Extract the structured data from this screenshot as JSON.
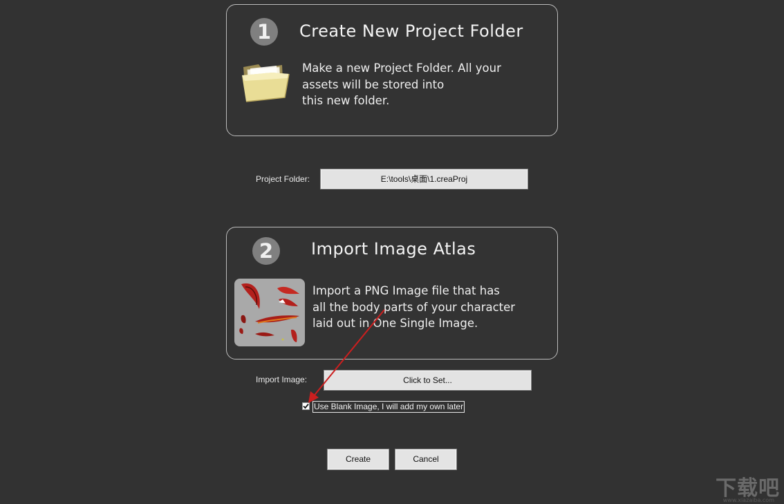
{
  "step1": {
    "number": "1",
    "title": "Create New Project Folder",
    "description_lines": [
      "Make a new Project Folder. All your",
      "assets will be stored into",
      "this new folder."
    ],
    "icon": "folder-icon"
  },
  "project_folder": {
    "label": "Project Folder:",
    "value": "E:\\tools\\桌面\\1.creaProj"
  },
  "step2": {
    "number": "2",
    "title": "Import Image Atlas",
    "description_lines": [
      "Import a PNG Image file that has",
      "all the body parts of your character",
      "laid out in One Single Image."
    ],
    "icon": "image-atlas-thumbnail"
  },
  "import_image": {
    "label": "Import Image:",
    "value": "Click to Set..."
  },
  "blank_image": {
    "label": "Use Blank Image, I will add my own later",
    "checked": true
  },
  "buttons": {
    "create": "Create",
    "cancel": "Cancel"
  },
  "watermark": {
    "text": "下载吧",
    "subtext": "www.xiazaiba.com"
  },
  "colors": {
    "background": "#323232",
    "panel_border": "#bdbdbd",
    "step_circle": "#808080",
    "annotation_arrow": "#cc1f1f"
  }
}
